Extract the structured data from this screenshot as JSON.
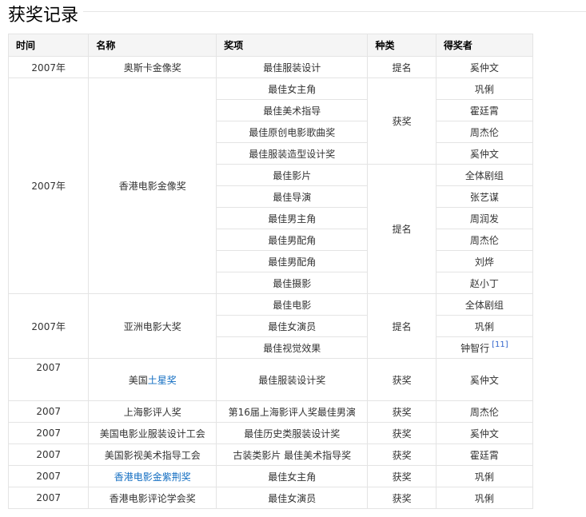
{
  "section_title": "获奖记录",
  "headers": [
    "时间",
    "名称",
    "奖项",
    "种类",
    "得奖者"
  ],
  "link_color": "#136ec2",
  "groups": [
    {
      "year": "2007年",
      "name": "奥斯卡金像奖",
      "subgroups": [
        {
          "category": "提名",
          "awards": [
            {
              "award": "最佳服装设计",
              "winner": "奚仲文"
            }
          ]
        }
      ]
    },
    {
      "year": "2007年",
      "name": "香港电影金像奖",
      "subgroups": [
        {
          "category": "获奖",
          "awards": [
            {
              "award": "最佳女主角",
              "winner": "巩俐"
            },
            {
              "award": "最佳美术指导",
              "winner": "霍廷霄"
            },
            {
              "award": "最佳原创电影歌曲奖",
              "winner": "周杰伦"
            },
            {
              "award": "最佳服装造型设计奖",
              "winner": "奚仲文"
            }
          ]
        },
        {
          "category": "提名",
          "awards": [
            {
              "award": "最佳影片",
              "winner": "全体剧组"
            },
            {
              "award": "最佳导演",
              "winner": "张艺谋"
            },
            {
              "award": "最佳男主角",
              "winner": "周润发"
            },
            {
              "award": "最佳男配角",
              "winner": "周杰伦"
            },
            {
              "award": "最佳男配角",
              "winner": "刘烨"
            },
            {
              "award": "最佳摄影",
              "winner": "赵小丁"
            }
          ]
        }
      ]
    },
    {
      "year": "2007年",
      "name": "亚洲电影大奖",
      "subgroups": [
        {
          "category": "提名",
          "awards": [
            {
              "award": "最佳电影",
              "winner": "全体剧组"
            },
            {
              "award": "最佳女演员",
              "winner": "巩俐"
            },
            {
              "award": "最佳视觉效果",
              "winner": "钟智行",
              "ref": "[11]"
            }
          ]
        }
      ]
    },
    {
      "year": "2007",
      "name": "美国",
      "name_link": "土星奖",
      "tall": true,
      "subgroups": [
        {
          "category": "获奖",
          "awards": [
            {
              "award": "最佳服装设计奖",
              "winner": "奚仲文"
            }
          ]
        }
      ]
    },
    {
      "year": "2007",
      "name": "上海影评人奖",
      "subgroups": [
        {
          "category": "获奖",
          "awards": [
            {
              "award": "第16届上海影评人奖最佳男演",
              "winner": "周杰伦"
            }
          ]
        }
      ]
    },
    {
      "year": "2007",
      "name": "美国电影业服装设计工会",
      "subgroups": [
        {
          "category": "获奖",
          "awards": [
            {
              "award": "最佳历史类服装设计奖",
              "winner": "奚仲文"
            }
          ]
        }
      ]
    },
    {
      "year": "2007",
      "name": "美国影视美术指导工会",
      "subgroups": [
        {
          "category": "获奖",
          "awards": [
            {
              "award": "古装类影片 最佳美术指导奖",
              "winner": "霍廷霄"
            }
          ]
        }
      ]
    },
    {
      "year": "2007",
      "name": "",
      "name_link": "香港电影金紫荆奖",
      "subgroups": [
        {
          "category": "获奖",
          "awards": [
            {
              "award": "最佳女主角",
              "winner": "巩俐"
            }
          ]
        }
      ]
    },
    {
      "year": "2007",
      "name": "香港电影评论学会奖",
      "subgroups": [
        {
          "category": "获奖",
          "awards": [
            {
              "award": "最佳女演员",
              "winner": "巩俐"
            }
          ]
        }
      ]
    }
  ]
}
